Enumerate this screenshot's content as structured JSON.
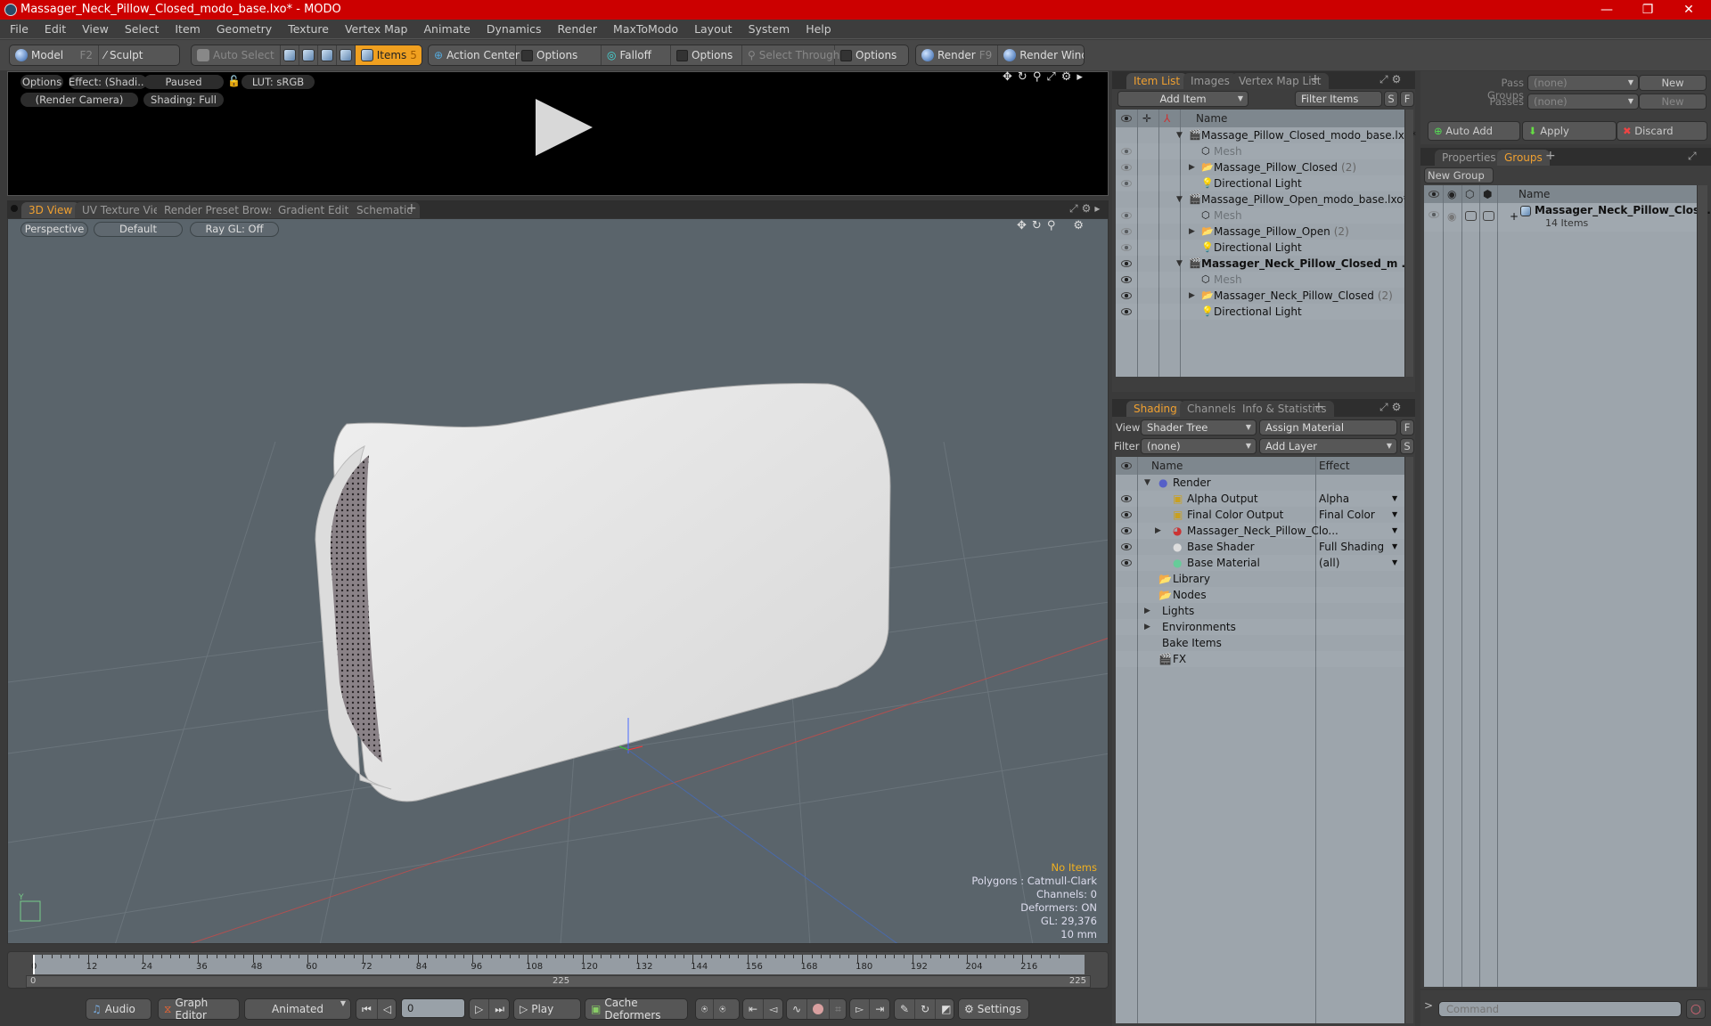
{
  "window": {
    "title": "Massager_Neck_Pillow_Closed_modo_base.lxo* - MODO",
    "controls": [
      "minimize",
      "maximize",
      "close"
    ]
  },
  "menu": [
    "File",
    "Edit",
    "View",
    "Select",
    "Item",
    "Geometry",
    "Texture",
    "Vertex Map",
    "Animate",
    "Dynamics",
    "Render",
    "MaxToModo",
    "Layout",
    "System",
    "Help"
  ],
  "toolbar": {
    "model": "Model",
    "model_key": "F2",
    "sculpt": "Sculpt",
    "auto_select": "Auto Select",
    "items": "Items",
    "items_key": "5",
    "action_center": "Action Center",
    "options1": "Options",
    "falloff": "Falloff",
    "options2": "Options",
    "select_through": "Select Through",
    "options3": "Options",
    "render": "Render",
    "render_key": "F9",
    "render_window": "Render Window"
  },
  "render_preview": {
    "options": "Options",
    "effect": "Effect: (Shadi...",
    "paused": "Paused",
    "lut": "LUT: sRGB",
    "camera": "(Render Camera)",
    "shading": "Shading: Full"
  },
  "view_tabs": [
    "3D View",
    "UV Texture View",
    "Render Preset Browser",
    "Gradient Editor",
    "Schematic",
    "+"
  ],
  "viewport": {
    "projection": "Perspective",
    "style": "Default",
    "raygl": "Ray GL: Off",
    "stats": {
      "selection": "No Items",
      "polygons": "Polygons : Catmull-Clark",
      "channels": "Channels: 0",
      "deformers": "Deformers: ON",
      "gl": "GL: 29,376",
      "unit": "10 mm"
    }
  },
  "timeline": {
    "ticks": [
      "0",
      "12",
      "24",
      "36",
      "48",
      "60",
      "72",
      "84",
      "96",
      "108",
      "120",
      "132",
      "144",
      "156",
      "168",
      "180",
      "192",
      "204",
      "216"
    ],
    "range_start": "0",
    "range_mid": "225",
    "range_end": "225",
    "current_frame": 0
  },
  "bottom_bar": {
    "audio": "Audio",
    "graph_editor": "Graph Editor",
    "animated": "Animated",
    "frame": "0",
    "play": "Play",
    "cache_deformers": "Cache Deformers",
    "settings": "Settings"
  },
  "item_list": {
    "tabs": [
      "Item List",
      "Images",
      "Vertex Map List",
      "+"
    ],
    "add_item": "Add Item",
    "filter": "Filter Items",
    "s_btn": "S",
    "f_btn": "F",
    "column_name": "Name",
    "rows": [
      {
        "label": "Massage_Pillow_Closed_modo_base.lxo*",
        "type": "scene",
        "level": 0,
        "eye": "none",
        "expanded": true
      },
      {
        "label": "Mesh",
        "type": "mesh",
        "level": 1,
        "eye": "dim",
        "dim": true
      },
      {
        "label": "Massage_Pillow_Closed",
        "count": "(2)",
        "type": "group",
        "level": 1,
        "eye": "dim",
        "collapsed": true
      },
      {
        "label": "Directional Light",
        "type": "light",
        "level": 1,
        "eye": "dim"
      },
      {
        "label": "Massage_Pillow_Open_modo_base.lxo*",
        "type": "scene",
        "level": 0,
        "eye": "none",
        "expanded": true
      },
      {
        "label": "Mesh",
        "type": "mesh",
        "level": 1,
        "eye": "dim",
        "dim": true
      },
      {
        "label": "Massage_Pillow_Open",
        "count": "(2)",
        "type": "group",
        "level": 1,
        "eye": "dim",
        "collapsed": true
      },
      {
        "label": "Directional Light",
        "type": "light",
        "level": 1,
        "eye": "dim"
      },
      {
        "label": "Massager_Neck_Pillow_Closed_m ...",
        "type": "scene",
        "level": 0,
        "eye": "on",
        "expanded": true,
        "bold": true
      },
      {
        "label": "Mesh",
        "type": "mesh",
        "level": 1,
        "eye": "on",
        "dim": true
      },
      {
        "label": "Massager_Neck_Pillow_Closed",
        "count": "(2)",
        "type": "group",
        "level": 1,
        "eye": "on",
        "collapsed": true
      },
      {
        "label": "Directional Light",
        "type": "light",
        "level": 1,
        "eye": "on"
      }
    ]
  },
  "shading": {
    "tabs": [
      "Shading",
      "Channels",
      "Info & Statistics",
      "+"
    ],
    "view_label": "View",
    "view_value": "Shader Tree",
    "assign_material": "Assign Material",
    "f_btn": "F",
    "filter_label": "Filter",
    "filter_value": "(none)",
    "add_layer": "Add Layer",
    "s_btn": "S",
    "col_name": "Name",
    "col_effect": "Effect",
    "rows": [
      {
        "label": "Render",
        "icon": "render-sphere",
        "level": 0,
        "effect": "",
        "eye": false,
        "expanded": true
      },
      {
        "label": "Alpha Output",
        "icon": "output",
        "level": 1,
        "effect": "Alpha",
        "eye": true
      },
      {
        "label": "Final Color Output",
        "icon": "output",
        "level": 1,
        "effect": "Final Color",
        "eye": true
      },
      {
        "label": "Massager_Neck_Pillow_Clo...",
        "icon": "material-group",
        "level": 1,
        "effect": "",
        "eye": true,
        "collapsed": true
      },
      {
        "label": "Base Shader",
        "icon": "shader",
        "level": 1,
        "effect": "Full Shading",
        "eye": true
      },
      {
        "label": "Base Material",
        "icon": "material",
        "level": 1,
        "effect": "(all)",
        "eye": true
      },
      {
        "label": "Library",
        "icon": "folder",
        "level": 0,
        "effect": ""
      },
      {
        "label": "Nodes",
        "icon": "folder",
        "level": 0,
        "effect": ""
      },
      {
        "label": "Lights",
        "icon": "",
        "level": -1,
        "effect": "",
        "collapsed": true
      },
      {
        "label": "Environments",
        "icon": "",
        "level": -1,
        "effect": "",
        "collapsed": true
      },
      {
        "label": "Bake Items",
        "icon": "",
        "level": -1,
        "effect": ""
      },
      {
        "label": "FX",
        "icon": "clapper",
        "level": 0,
        "effect": ""
      }
    ]
  },
  "passes": {
    "pass_groups_label": "Pass Groups",
    "pass_groups_value": "(none)",
    "new1": "New",
    "passes_label": "Passes",
    "passes_value": "(none)",
    "new2": "New",
    "auto_add": "Auto Add",
    "apply": "Apply",
    "discard": "Discard"
  },
  "groups": {
    "tabs": [
      "Properties",
      "Groups",
      "+"
    ],
    "new_group": "New Group",
    "col_name": "Name",
    "items": [
      {
        "name": "Massager_Neck_Pillow_Close...",
        "sub": "14 Items"
      }
    ]
  },
  "command": {
    "prompt": ">",
    "placeholder": "Command"
  }
}
